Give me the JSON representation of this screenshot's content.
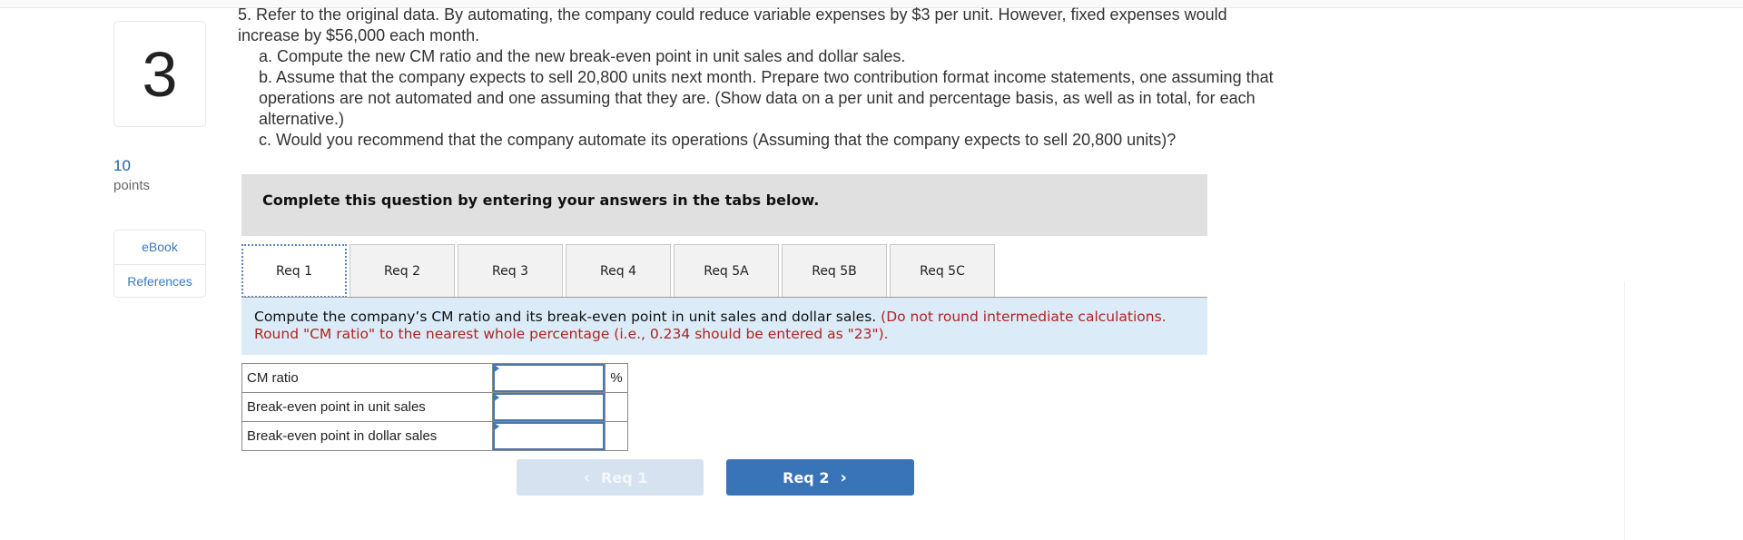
{
  "question": {
    "number": "3",
    "points_value": "10",
    "points_label": "points",
    "side_links": [
      "eBook",
      "References"
    ],
    "text_line1": "5. Refer to the original data. By automating, the company could reduce variable expenses by $3 per unit. However, fixed expenses would increase by $56,000 each month.",
    "part_a": "a. Compute the new CM ratio and the new break-even point in unit sales and dollar sales.",
    "part_b": "b. Assume that the company expects to sell 20,800 units next month. Prepare two contribution format income statements, one assuming that operations are not automated and one assuming that they are. (Show data on a per unit and percentage basis, as well as in total, for each alternative.)",
    "part_c": "c. Would you recommend that the company automate its operations (Assuming that the company expects to sell 20,800 units)?"
  },
  "banner": {
    "text": "Complete this question by entering your answers in the tabs below."
  },
  "tabs": [
    {
      "label": "Req 1",
      "active": true
    },
    {
      "label": "Req 2",
      "active": false
    },
    {
      "label": "Req 3",
      "active": false
    },
    {
      "label": "Req 4",
      "active": false
    },
    {
      "label": "Req 5A",
      "active": false
    },
    {
      "label": "Req 5B",
      "active": false
    },
    {
      "label": "Req 5C",
      "active": false
    }
  ],
  "instructions": {
    "main": "Compute the company’s CM ratio and its break-even point in unit sales and dollar sales.",
    "note": "(Do not round intermediate calculations. Round \"CM ratio\" to the nearest whole percentage (i.e., 0.234 should be entered as \"23\")."
  },
  "answer_rows": [
    {
      "label": "CM ratio",
      "value": "",
      "unit": "%"
    },
    {
      "label": "Break-even point in unit sales",
      "value": "",
      "unit": ""
    },
    {
      "label": "Break-even point in dollar sales",
      "value": "",
      "unit": ""
    }
  ],
  "nav": {
    "prev_label": "Req 1",
    "next_label": "Req 2",
    "prev_icon": "chevron-left-icon",
    "next_icon": "chevron-right-icon"
  },
  "colors": {
    "accent": "#3a74b8",
    "link": "#3a78c0",
    "note_red": "#b22222",
    "instruction_bg": "#dbecf8",
    "banner_bg": "#e0e0e0"
  }
}
